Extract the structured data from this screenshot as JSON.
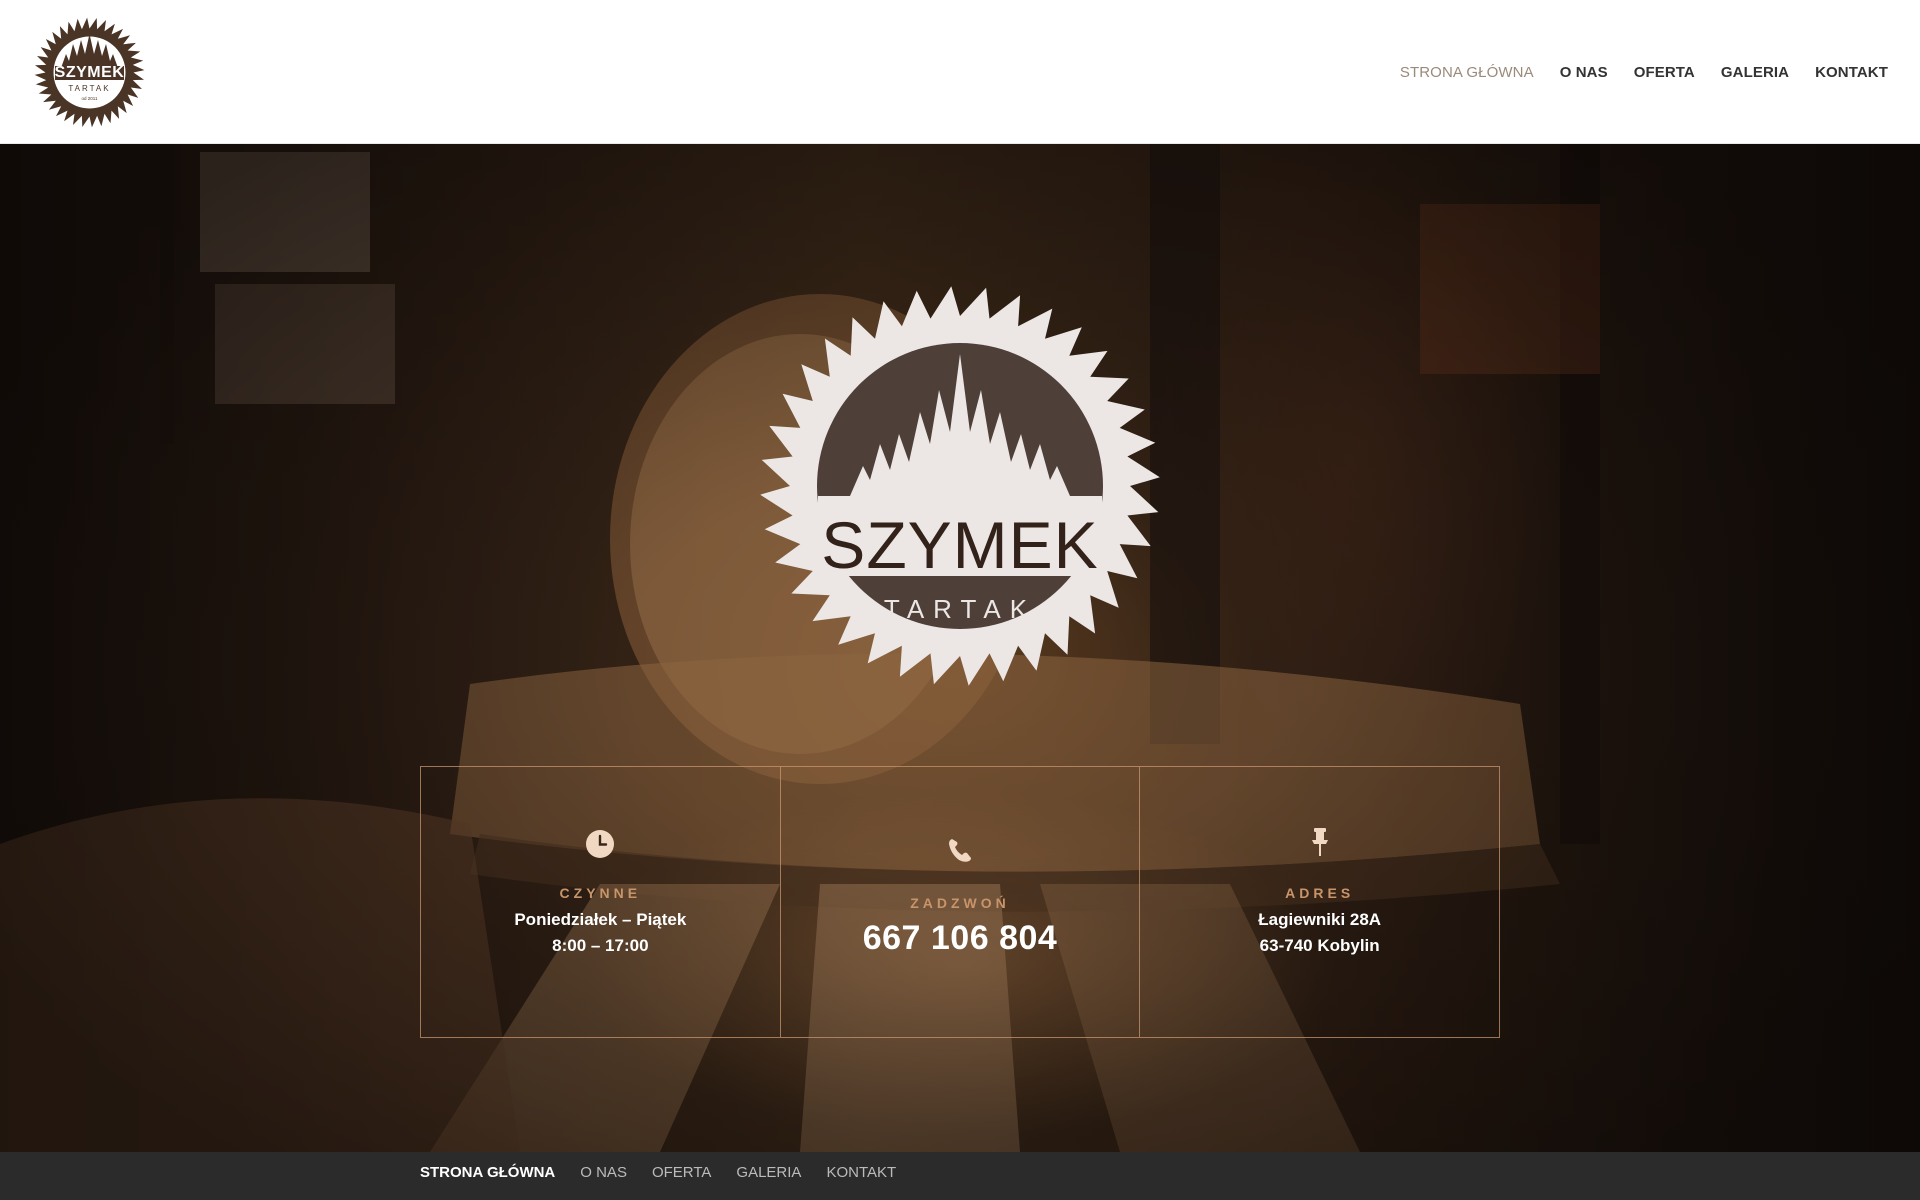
{
  "brand": {
    "name": "SZYMEK",
    "subtitle": "TARTAK",
    "since": "OD 2011",
    "header_since": "od 2011"
  },
  "top_nav": [
    {
      "label": "STRONA GŁÓWNA",
      "active": true
    },
    {
      "label": "O NAS",
      "active": false
    },
    {
      "label": "OFERTA",
      "active": false
    },
    {
      "label": "GALERIA",
      "active": false
    },
    {
      "label": "KONTAKT",
      "active": false
    }
  ],
  "info": {
    "hours": {
      "icon": "clock-icon",
      "heading": "CZYNNE",
      "line1": "Poniedziałek – Piątek",
      "line2": "8:00 – 17:00"
    },
    "call": {
      "icon": "phone-icon",
      "heading": "ZADZWOŃ",
      "phone": "667 106 804"
    },
    "address": {
      "icon": "pin-icon",
      "heading": "ADRES",
      "line1": "Łagiewniki 28A",
      "line2": "63-740 Kobylin"
    }
  },
  "footer_nav": [
    {
      "label": "STRONA GŁÓWNA",
      "active": true
    },
    {
      "label": "O NAS",
      "active": false
    },
    {
      "label": "OFERTA",
      "active": false
    },
    {
      "label": "GALERIA",
      "active": false
    },
    {
      "label": "KONTAKT",
      "active": false
    }
  ],
  "colors": {
    "accent": "#c8946a",
    "nav_active": "#9a8a7a",
    "logo_brown": "#4a3426",
    "logo_light": "#ece7e5",
    "footer_bg": "#2b2b2b"
  }
}
